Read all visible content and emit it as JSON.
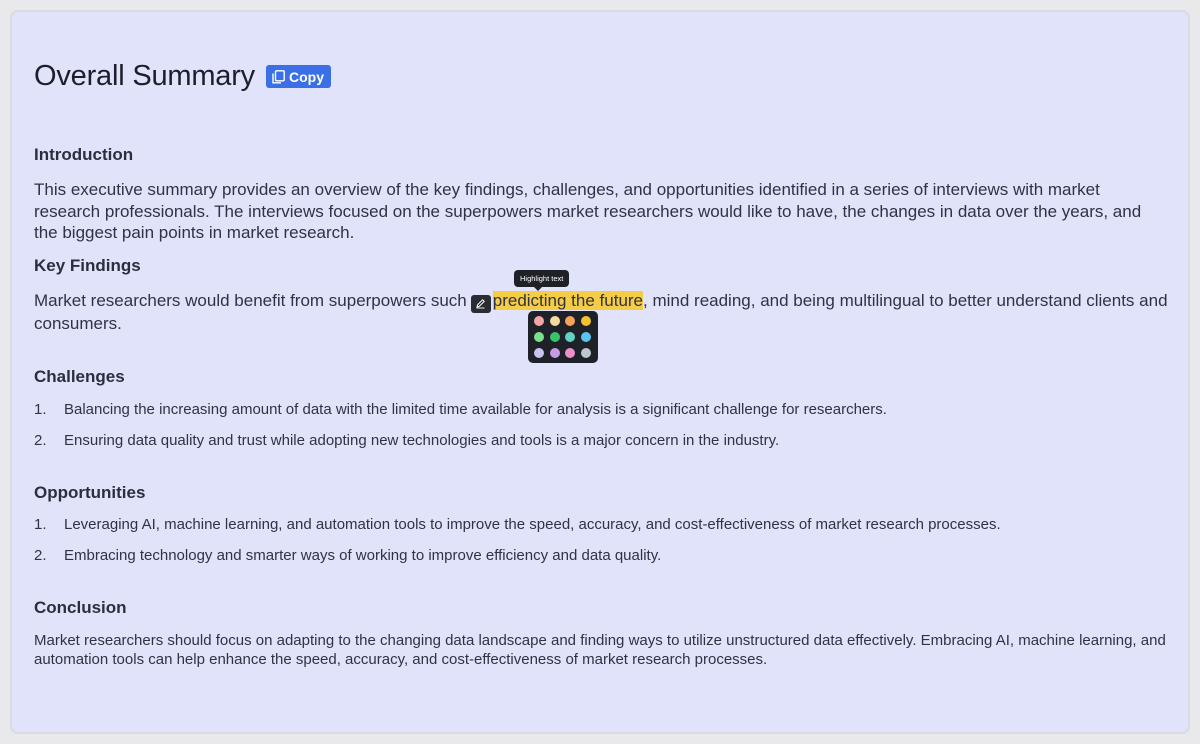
{
  "header": {
    "title": "Overall Summary",
    "copy_label": "Copy"
  },
  "sections": {
    "introduction": {
      "heading": "Introduction",
      "text": "This executive summary provides an overview of the key findings, challenges, and opportunities identified in a series of interviews with market research professionals. The interviews focused on the superpowers market researchers would like to have, the changes in data over the years, and the biggest pain points in market research."
    },
    "key_findings": {
      "heading": "Key Findings",
      "text_before": "Market researchers would benefit from superpowers such",
      "highlighted": "predicting the future",
      "text_after": ", mind reading, and being multilingual to better understand clients and consumers."
    },
    "challenges": {
      "heading": "Challenges",
      "items": [
        {
          "num": "1.",
          "text": "Balancing the increasing amount of data with the limited time available for analysis is a significant challenge for researchers."
        },
        {
          "num": "2.",
          "text": "Ensuring data quality and trust while adopting new technologies and tools is a major concern in the industry."
        }
      ]
    },
    "opportunities": {
      "heading": "Opportunities",
      "items": [
        {
          "num": "1.",
          "text": "Leveraging AI, machine learning, and automation tools to improve the speed, accuracy, and cost-effectiveness of market research processes."
        },
        {
          "num": "2.",
          "text": "Embracing technology and smarter ways of working to improve efficiency and data quality."
        }
      ]
    },
    "conclusion": {
      "heading": "Conclusion",
      "text": "Market researchers should focus on adapting to the changing data landscape and finding ways to utilize unstructured data effectively. Embracing AI, machine learning, and automation tools can help enhance the speed, accuracy, and cost-effectiveness of market research processes."
    }
  },
  "highlight_tool": {
    "tooltip": "Highlight text",
    "icon": "pen-icon",
    "active_color": "#f5cd45",
    "palette": [
      "#f4a6a6",
      "#f7d9a0",
      "#f5a25b",
      "#f5c22c",
      "#7be08a",
      "#38c46a",
      "#5fd3c4",
      "#5cc4ee",
      "#c9c3f2",
      "#c79be6",
      "#ef8fc9",
      "#bcc6cf"
    ]
  },
  "colors": {
    "page_background": "#e1e3fb",
    "accent": "#3b6fe6"
  }
}
